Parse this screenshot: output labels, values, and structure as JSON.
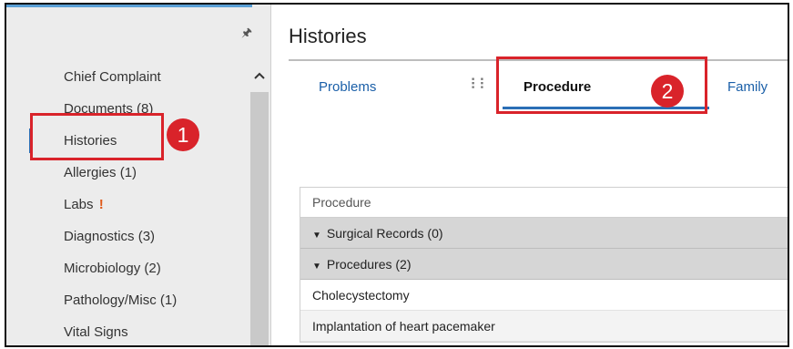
{
  "sidebar": {
    "items": [
      {
        "label": "Chief Complaint",
        "count": ""
      },
      {
        "label": "Documents",
        "count": "(8)"
      },
      {
        "label": "Histories",
        "count": ""
      },
      {
        "label": "Allergies",
        "count": "(1)"
      },
      {
        "label": "Labs",
        "count": "",
        "alert": "!"
      },
      {
        "label": "Diagnostics",
        "count": "(3)"
      },
      {
        "label": "Microbiology",
        "count": "(2)"
      },
      {
        "label": "Pathology/Misc",
        "count": "(1)"
      },
      {
        "label": "Vital Signs",
        "count": ""
      }
    ],
    "active_item": "Histories",
    "pin_icon": "pin-icon",
    "scroll_up_icon": "chevron-up-icon"
  },
  "main": {
    "title": "Histories",
    "tabs": [
      {
        "label": "Problems"
      },
      {
        "label": "Procedure"
      },
      {
        "label": "Family"
      }
    ],
    "selected_tab": "Procedure",
    "grid": {
      "column_header": "Procedure",
      "groups": [
        {
          "label": "Surgical Records",
          "count": "(0)",
          "rows": []
        },
        {
          "label": "Procedures",
          "count": "(2)",
          "rows": [
            "Cholecystectomy",
            "Implantation of heart pacemaker"
          ]
        }
      ]
    }
  },
  "annotations": {
    "badge1": "1",
    "badge2": "2"
  },
  "colors": {
    "callout": "#d9232a",
    "accent": "#2b6fb6",
    "link": "#1a5fa8"
  }
}
